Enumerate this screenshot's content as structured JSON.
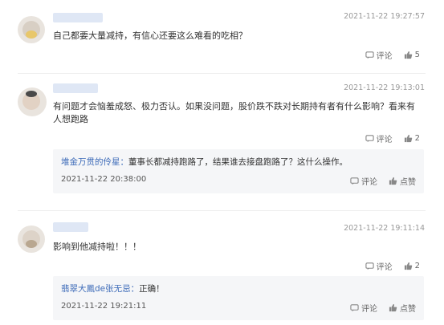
{
  "comments": [
    {
      "time": "2021-11-22 19:27:57",
      "text": "自己都要大量减持，有信心还要这么难看的吃相？",
      "reply_label": "评论",
      "likes": "5"
    },
    {
      "time": "2021-11-22 19:13:01",
      "text": "有问题才会恼羞成怒、极力否认。如果没问题，股价跌不跌对长期持有者有什么影响？看来有人想跑路",
      "reply_label": "评论",
      "likes": "2",
      "reply": {
        "author": "堆金万贯的伶星：",
        "text": "董事长都减持跑路了，结果谁去接盘跑路了？这什么操作。",
        "time": "2021-11-22 20:38:00",
        "reply_label": "评论",
        "like_label": "点赞"
      }
    },
    {
      "time": "2021-11-22 19:11:14",
      "text": "影响到他减持啦！！！",
      "reply_label": "评论",
      "likes": "2",
      "reply": {
        "author": "翡翠大鳳de张无忌：",
        "text": "正确！",
        "time": "2021-11-22 19:21:11",
        "reply_label": "评论",
        "like_label": "点赞"
      }
    }
  ],
  "icons": {
    "comment": "comment-bubble-icon",
    "like": "thumbs-up-icon"
  }
}
